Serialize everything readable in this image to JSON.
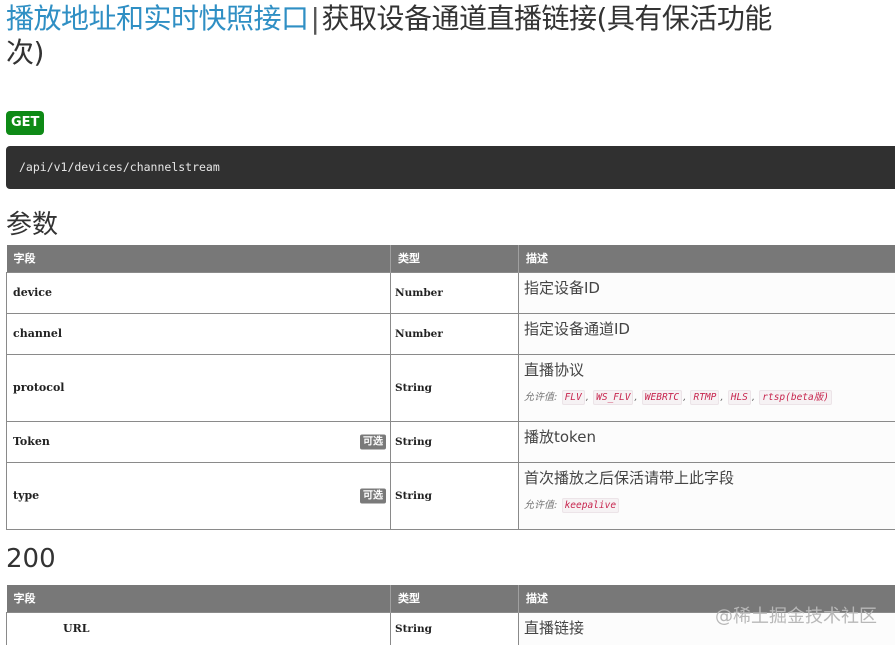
{
  "title": {
    "group": "播放地址和实时快照接口",
    "separator": "|",
    "api_name": "获取设备通道直播链接(具有保活功能",
    "api_name_wrap": "次)"
  },
  "method": "GET",
  "endpoint": "/api/v1/devices/channelstream",
  "params_section": {
    "title": "参数",
    "headers": [
      "字段",
      "类型",
      "描述"
    ],
    "rows": [
      {
        "field": "device",
        "type": "Number",
        "desc": "指定设备ID",
        "optional": "",
        "allowed_label": "",
        "allowed": []
      },
      {
        "field": "channel",
        "type": "Number",
        "desc": "指定设备通道ID",
        "optional": "",
        "allowed_label": "",
        "allowed": []
      },
      {
        "field": "protocol",
        "type": "String",
        "desc": "直播协议",
        "optional": "",
        "allowed_label": "允许值:",
        "allowed": [
          "FLV",
          "WS_FLV",
          "WEBRTC",
          "RTMP",
          "HLS",
          "rtsp(beta版)"
        ]
      },
      {
        "field": "Token",
        "type": "String",
        "desc": "播放token",
        "optional": "可选",
        "allowed_label": "",
        "allowed": []
      },
      {
        "field": "type",
        "type": "String",
        "desc": "首次播放之后保活请带上此字段",
        "optional": "可选",
        "allowed_label": "允许值:",
        "allowed": [
          "keepalive"
        ]
      }
    ]
  },
  "response_section": {
    "title": "200",
    "headers": [
      "字段",
      "类型",
      "描述"
    ],
    "rows": [
      {
        "field": "URL",
        "type": "String",
        "desc": "直播链接"
      }
    ]
  },
  "watermark": "@稀土掘金技术社区",
  "colors": {
    "group_link": "#2f8fc4",
    "get_badge": "#0e8a16",
    "endpoint_bg": "#303030",
    "table_header": "#787878",
    "code_text": "#c7254e"
  }
}
